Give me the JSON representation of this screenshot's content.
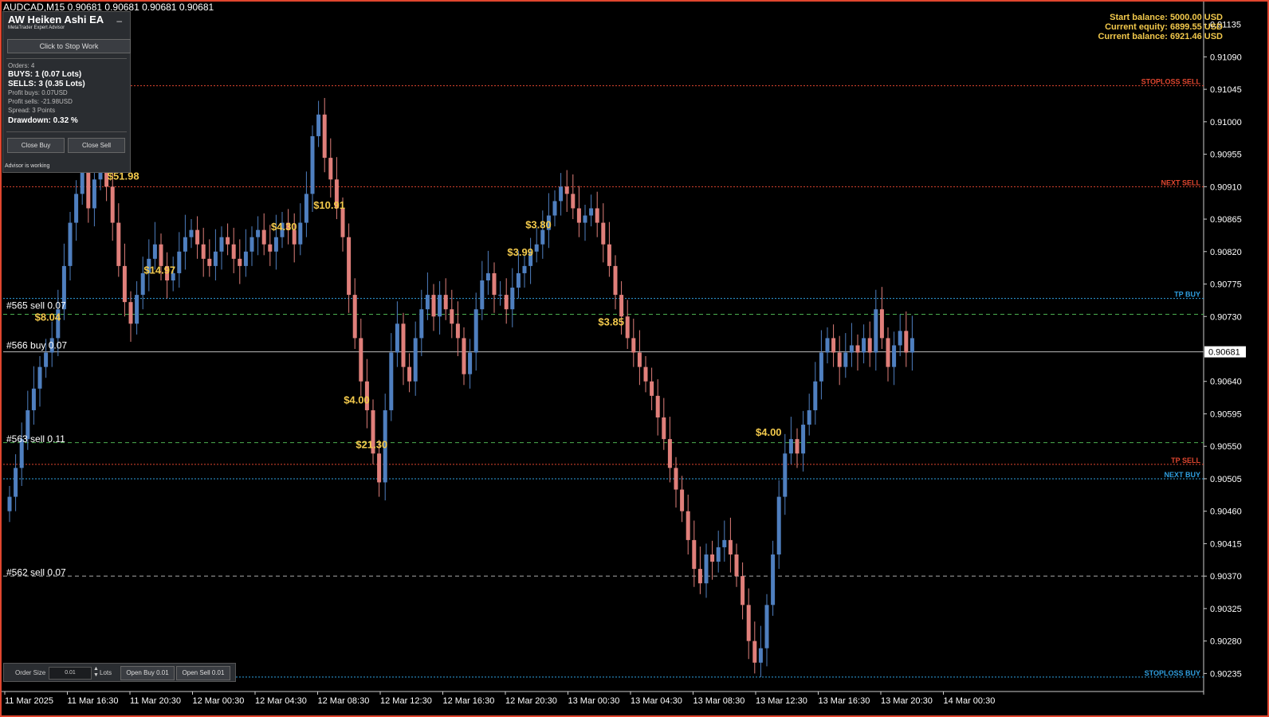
{
  "symbol": {
    "title": "AUDCAD,M15  0.90681 0.90681 0.90681 0.90681"
  },
  "stats": {
    "start_balance": "Start balance: 5000.00 USD",
    "current_equity": "Current equity: 6899.55 USD",
    "current_balance": "Current balance: 6921.46 USD"
  },
  "ea_panel": {
    "title": "AW Heiken Ashi EA",
    "subtitle": "MetaTrader Expert Advisor",
    "minimize": "–",
    "stop_button": "Click to Stop Work",
    "orders": "Orders: 4",
    "buys": "BUYS: 1 (0.07 Lots)",
    "sells": "SELLS: 3 (0.35 Lots)",
    "profit_buys": "Profit buys: 0.07USD",
    "profit_sells": "Profit sells: -21.98USD",
    "spread": "Spread: 3 Points",
    "drawdown": "Drawdown: 0.32 %",
    "close_buy": "Close Buy",
    "close_sell": "Close Sell",
    "status": "Advisor is working"
  },
  "order_panel": {
    "order_size_label": "Order Size",
    "order_size_value": "0.01",
    "lots_label": "Lots",
    "open_buy": "Open Buy 0.01",
    "open_sell": "Open Sell 0.01"
  },
  "colors": {
    "bull": "#4f7fbf",
    "bear": "#e07f7a",
    "stoploss": "#e0462f",
    "tp_buy": "#2f9fe0",
    "green_dash": "#4caf50",
    "gold": "#f2c94c",
    "frame": "#e0462f"
  },
  "chart_data": {
    "type": "candlestick",
    "title": "AUDCAD,M15",
    "price_axis": {
      "ticks": [
        "0.91135",
        "0.91090",
        "0.91045",
        "0.91000",
        "0.90955",
        "0.90910",
        "0.90865",
        "0.90820",
        "0.90775",
        "0.90730",
        "0.90640",
        "0.90595",
        "0.90550",
        "0.90505",
        "0.90460",
        "0.90415",
        "0.90370",
        "0.90325",
        "0.90280",
        "0.90235"
      ],
      "range": [
        0.9021,
        0.9116
      ],
      "current_price": "0.90681"
    },
    "time_axis": {
      "ticks": [
        "11 Mar 2025",
        "11 Mar 16:30",
        "11 Mar 20:30",
        "12 Mar 00:30",
        "12 Mar 04:30",
        "12 Mar 08:30",
        "12 Mar 12:30",
        "12 Mar 16:30",
        "12 Mar 20:30",
        "13 Mar 00:30",
        "13 Mar 04:30",
        "13 Mar 08:30",
        "13 Mar 12:30",
        "13 Mar 16:30",
        "13 Mar 20:30",
        "14 Mar 00:30"
      ]
    },
    "levels": [
      {
        "label": "STOPLOSS SELL",
        "price": 0.9105,
        "style": "stoploss"
      },
      {
        "label": "NEXT SELL",
        "price": 0.9091,
        "style": "stoploss"
      },
      {
        "label": "TP BUY",
        "price": 0.90755,
        "style": "tp_buy"
      },
      {
        "label": "",
        "price": 0.90733,
        "style": "green"
      },
      {
        "label": "",
        "price": 0.90681,
        "style": "current"
      },
      {
        "label": "",
        "price": 0.90555,
        "style": "green"
      },
      {
        "label": "TP SELL",
        "price": 0.90525,
        "style": "stoploss"
      },
      {
        "label": "NEXT BUY",
        "price": 0.90505,
        "style": "tp_buy"
      },
      {
        "label": "",
        "price": 0.9037,
        "style": "grey"
      },
      {
        "label": "STOPLOSS BUY",
        "price": 0.9023,
        "style": "tp_buy"
      }
    ],
    "orders": [
      {
        "label": "#565 sell 0.07",
        "price": 0.90745
      },
      {
        "label": "#566 buy 0.07",
        "price": 0.9069
      },
      {
        "label": "#563 sell 0.11",
        "price": 0.9056
      },
      {
        "label": "#562 sell 0.07",
        "price": 0.90375
      }
    ],
    "profit_labels": [
      {
        "text": "$51.98",
        "price": 0.90925,
        "bar": 18
      },
      {
        "text": "$8.04",
        "price": 0.9073,
        "bar": 6
      },
      {
        "text": "$14.97",
        "price": 0.90795,
        "bar": 24
      },
      {
        "text": "$4.30",
        "price": 0.90855,
        "bar": 45
      },
      {
        "text": "$10.91",
        "price": 0.90885,
        "bar": 52
      },
      {
        "text": "$4.00",
        "price": 0.90615,
        "bar": 57
      },
      {
        "text": "$21.30",
        "price": 0.90553,
        "bar": 59
      },
      {
        "text": "$3.80",
        "price": 0.90858,
        "bar": 87
      },
      {
        "text": "$3.99",
        "price": 0.9082,
        "bar": 84
      },
      {
        "text": "$3.85",
        "price": 0.90723,
        "bar": 99
      },
      {
        "text": "$4.00",
        "price": 0.9057,
        "bar": 125
      }
    ],
    "candles": [
      0.9048,
      0.9052,
      0.9056,
      0.906,
      0.9063,
      0.9066,
      0.9068,
      0.907,
      0.9074,
      0.908,
      0.9086,
      0.909,
      0.9093,
      0.9088,
      0.9092,
      0.9096,
      0.9091,
      0.9086,
      0.908,
      0.9075,
      0.9072,
      0.9076,
      0.9079,
      0.9081,
      0.9083,
      0.908,
      0.9078,
      0.9079,
      0.9082,
      0.9084,
      0.9085,
      0.9083,
      0.9081,
      0.908,
      0.9082,
      0.9084,
      0.9083,
      0.9081,
      0.908,
      0.9082,
      0.9084,
      0.9085,
      0.9083,
      0.9082,
      0.9084,
      0.9086,
      0.9085,
      0.9083,
      0.9086,
      0.909,
      0.9098,
      0.9101,
      0.9095,
      0.9092,
      0.9088,
      0.9084,
      0.9076,
      0.907,
      0.9064,
      0.906,
      0.9054,
      0.905,
      0.906,
      0.9068,
      0.9072,
      0.9066,
      0.9064,
      0.907,
      0.9074,
      0.9076,
      0.9073,
      0.9076,
      0.9074,
      0.9072,
      0.907,
      0.9065,
      0.9068,
      0.9074,
      0.9078,
      0.9079,
      0.9076,
      0.9076,
      0.9074,
      0.9077,
      0.9079,
      0.908,
      0.9082,
      0.9083,
      0.9085,
      0.9087,
      0.9089,
      0.9091,
      0.909,
      0.9088,
      0.9086,
      0.9087,
      0.9088,
      0.9086,
      0.9083,
      0.908,
      0.9076,
      0.9073,
      0.907,
      0.9068,
      0.9066,
      0.9064,
      0.9062,
      0.9059,
      0.9056,
      0.9052,
      0.9049,
      0.9046,
      0.9042,
      0.9038,
      0.9036,
      0.904,
      0.9039,
      0.9041,
      0.9042,
      0.904,
      0.9037,
      0.9033,
      0.9028,
      0.9025,
      0.9027,
      0.9033,
      0.904,
      0.9048,
      0.9054,
      0.9056,
      0.9054,
      0.9058,
      0.906,
      0.9064,
      0.9068,
      0.907,
      0.9068,
      0.9066,
      0.9068,
      0.9069,
      0.9068,
      0.907,
      0.9068,
      0.9074,
      0.907,
      0.9066,
      0.9069,
      0.9071,
      0.9068,
      0.907
    ]
  }
}
